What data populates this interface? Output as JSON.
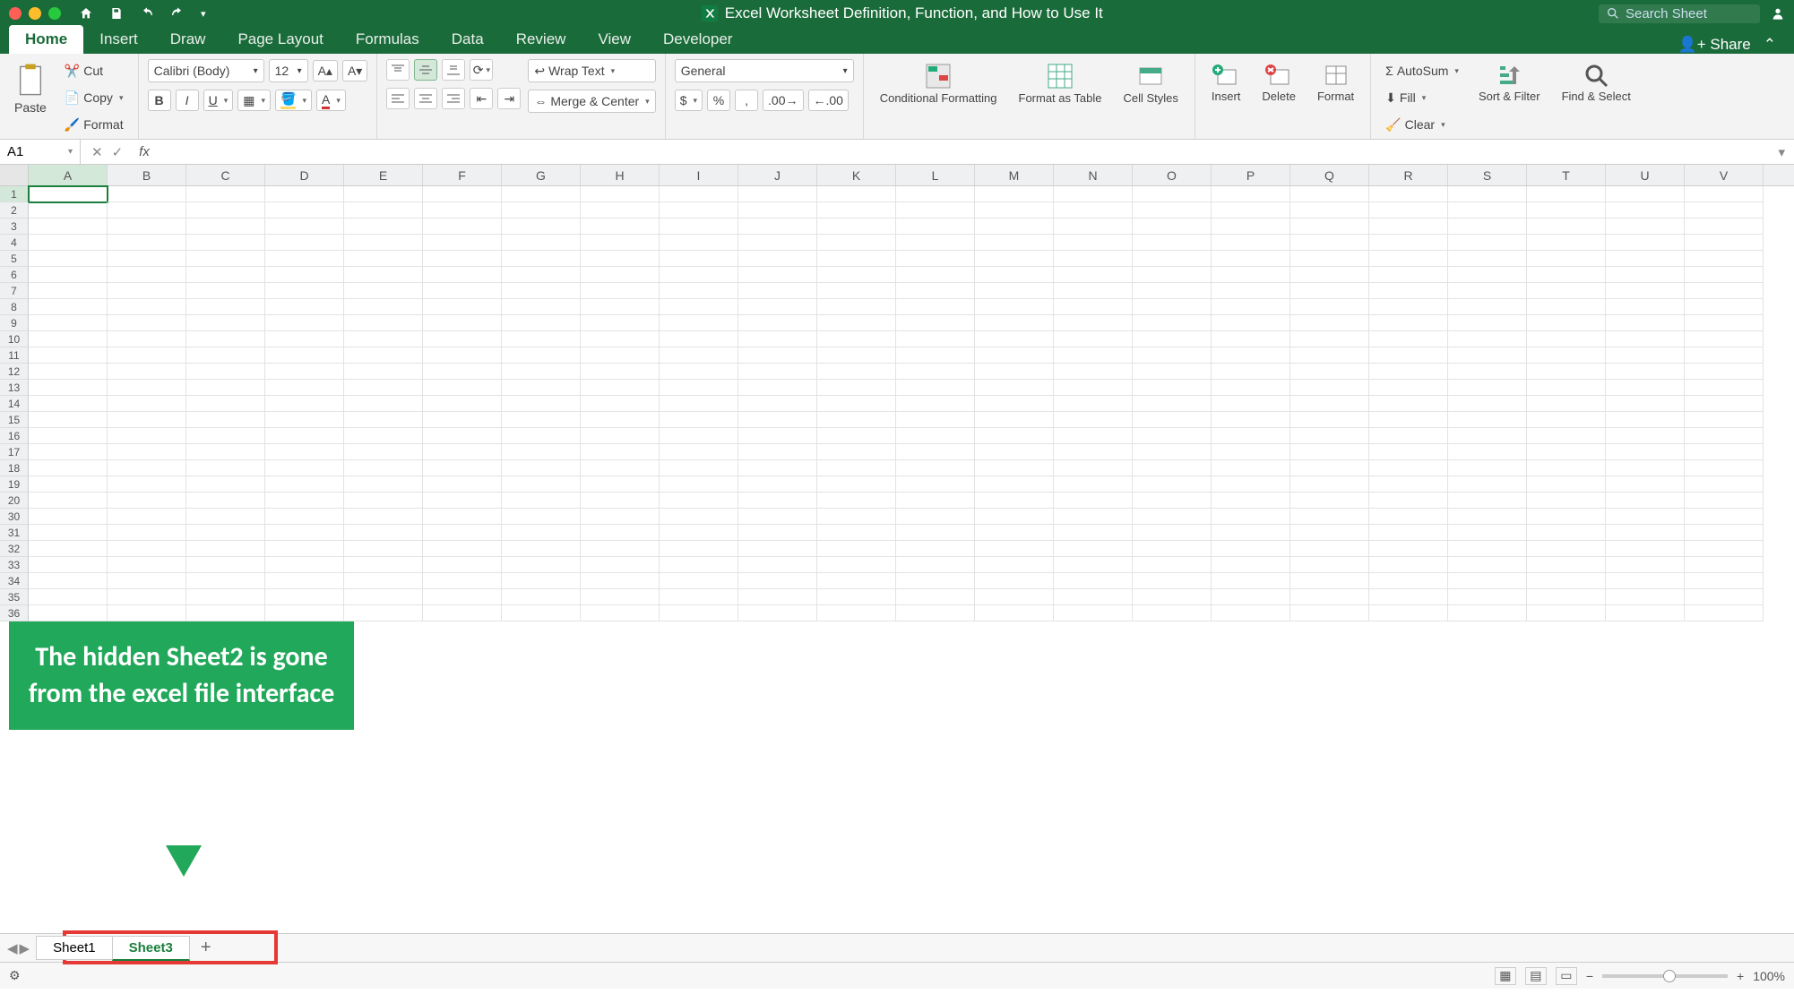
{
  "title": "Excel Worksheet Definition, Function, and How to Use It",
  "search_placeholder": "Search Sheet",
  "share_label": "Share",
  "tabs": [
    "Home",
    "Insert",
    "Draw",
    "Page Layout",
    "Formulas",
    "Data",
    "Review",
    "View",
    "Developer"
  ],
  "active_tab": "Home",
  "clipboard": {
    "paste": "Paste",
    "cut": "Cut",
    "copy": "Copy",
    "format_painter": "Format"
  },
  "font": {
    "name": "Calibri (Body)",
    "size": "12"
  },
  "alignment": {
    "wrap": "Wrap Text",
    "merge": "Merge & Center"
  },
  "number": {
    "format": "General"
  },
  "styles": {
    "cond": "Conditional Formatting",
    "table": "Format as Table",
    "cell": "Cell Styles"
  },
  "cells": {
    "insert": "Insert",
    "delete": "Delete",
    "format": "Format"
  },
  "editing": {
    "autosum": "AutoSum",
    "fill": "Fill",
    "clear": "Clear",
    "sort": "Sort & Filter",
    "find": "Find & Select"
  },
  "name_box": "A1",
  "columns": [
    "A",
    "B",
    "C",
    "D",
    "E",
    "F",
    "G",
    "H",
    "I",
    "J",
    "K",
    "L",
    "M",
    "N",
    "O",
    "P",
    "Q",
    "R",
    "S",
    "T",
    "U",
    "V"
  ],
  "rows_visible": [
    "1",
    "2",
    "3",
    "4",
    "5",
    "6",
    "7",
    "8",
    "9",
    "10",
    "11",
    "12",
    "13",
    "14",
    "15",
    "16",
    "17",
    "18",
    "19",
    "20",
    "30",
    "31",
    "32",
    "33",
    "34",
    "35",
    "36"
  ],
  "annotation_text": "The hidden Sheet2 is gone from the excel file interface",
  "sheets": [
    "Sheet1",
    "Sheet3"
  ],
  "active_sheet": "Sheet3",
  "zoom": "100%"
}
